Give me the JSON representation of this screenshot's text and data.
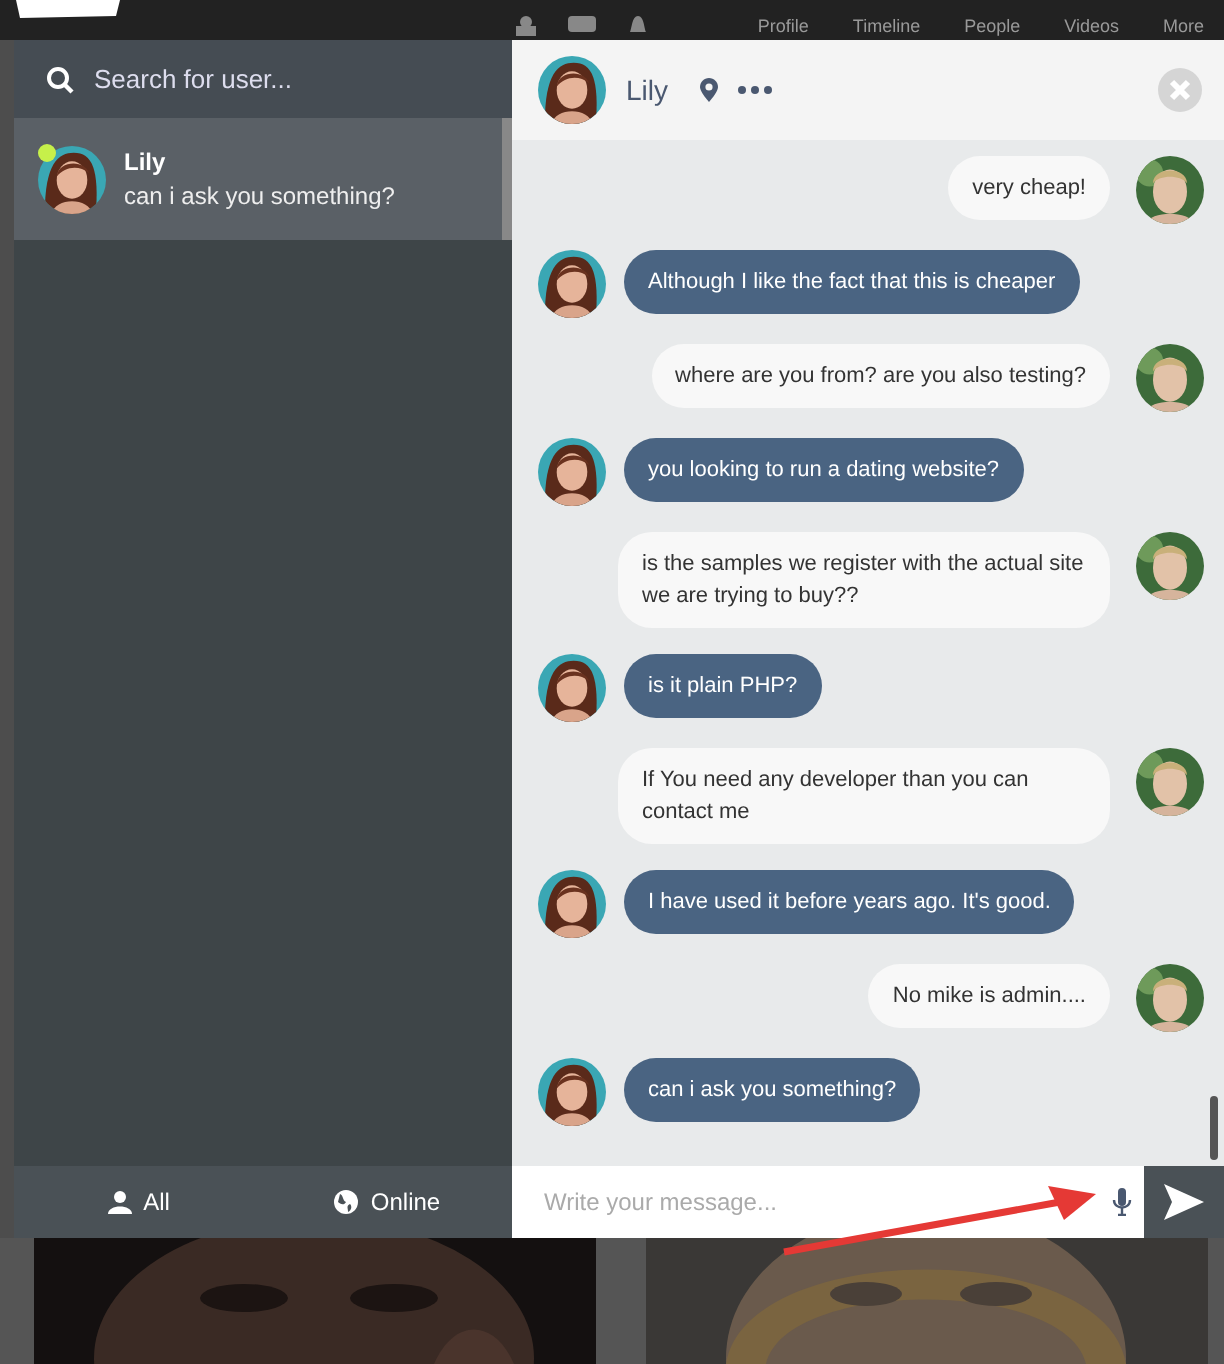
{
  "top_nav": {
    "items": [
      "Profile",
      "Timeline",
      "People",
      "Videos",
      "More"
    ]
  },
  "sidebar": {
    "search": {
      "placeholder": "Search for user..."
    },
    "contacts": [
      {
        "name": "Lily",
        "last_message": "can i ask you something?",
        "online": true,
        "selected": true
      }
    ],
    "filters": [
      {
        "label": "All",
        "kind": "user"
      },
      {
        "label": "Online",
        "kind": "globe"
      }
    ]
  },
  "chat": {
    "title": "Lily",
    "messages": [
      {
        "kind": "sent",
        "text": "very cheap!"
      },
      {
        "kind": "received",
        "text": "Although I like the fact that this is cheaper"
      },
      {
        "kind": "sent",
        "text": "where are you from? are you also testing?"
      },
      {
        "kind": "received",
        "text": "you looking to run a dating website?"
      },
      {
        "kind": "sent",
        "text": "is the samples we register with the actual site we are trying to buy??"
      },
      {
        "kind": "received",
        "text": "is it plain PHP?"
      },
      {
        "kind": "sent",
        "text": "If You need any developer than you can contact me"
      },
      {
        "kind": "received",
        "text": "I have used it before years ago. It's good."
      },
      {
        "kind": "sent",
        "text": "No mike is admin...."
      },
      {
        "kind": "received",
        "text": "can i ask you something?"
      }
    ],
    "composer": {
      "placeholder": "Write your message..."
    }
  }
}
